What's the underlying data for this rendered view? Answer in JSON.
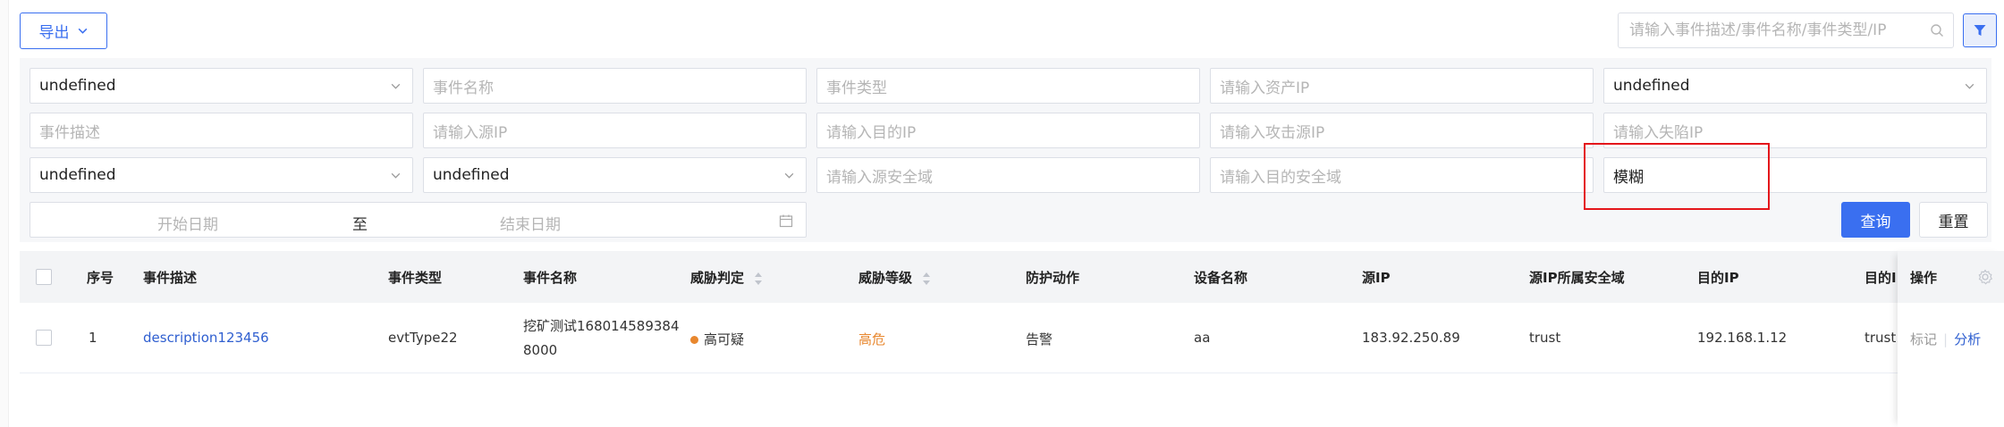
{
  "toolbar": {
    "export_label": "导出",
    "search_placeholder": "请输入事件描述/事件名称/事件类型/IP"
  },
  "filters": {
    "row1": {
      "select1_value": "undefined",
      "event_name_placeholder": "事件名称",
      "event_type_placeholder": "事件类型",
      "asset_ip_placeholder": "请输入资产IP",
      "select2_value": "undefined"
    },
    "row2": {
      "event_desc_placeholder": "事件描述",
      "src_ip_placeholder": "请输入源IP",
      "dst_ip_placeholder": "请输入目的IP",
      "attack_src_ip_placeholder": "请输入攻击源IP",
      "victim_ip_placeholder": "请输入失陷IP"
    },
    "row3": {
      "select3_value": "undefined",
      "select4_value": "undefined",
      "src_zone_placeholder": "请输入源安全域",
      "dst_zone_placeholder": "请输入目的安全域",
      "match_mode_value": "模糊"
    },
    "date_range": {
      "start_placeholder": "开始日期",
      "separator": "至",
      "end_placeholder": "结束日期"
    },
    "query_label": "查询",
    "reset_label": "重置"
  },
  "table": {
    "headers": {
      "index": "序号",
      "event_desc": "事件描述",
      "event_type": "事件类型",
      "event_name": "事件名称",
      "threat_judgment": "威胁判定",
      "threat_level": "威胁等级",
      "protect_action": "防护动作",
      "device_name": "设备名称",
      "src_ip": "源IP",
      "src_zone": "源IP所属安全域",
      "dst_ip": "目的IP",
      "dst_zone_truncated": "目的II",
      "operations": "操作"
    },
    "rows": [
      {
        "index": "1",
        "event_desc": "description123456",
        "event_type": "evtType22",
        "event_name_line1": "挖矿测试168014589384",
        "event_name_line2": "8000",
        "threat_judgment": "高可疑",
        "threat_level": "高危",
        "protect_action": "告警",
        "device_name": "aa",
        "src_ip": "183.92.250.89",
        "src_zone": "trust",
        "dst_ip": "192.168.1.12",
        "dst_zone": "trust",
        "op_mark": "标记",
        "op_analyze": "分析"
      }
    ]
  },
  "colors": {
    "primary": "#3a6ff0",
    "highlight": "#e4161b",
    "risk": "#e8872e",
    "link": "#2f5fd0"
  }
}
